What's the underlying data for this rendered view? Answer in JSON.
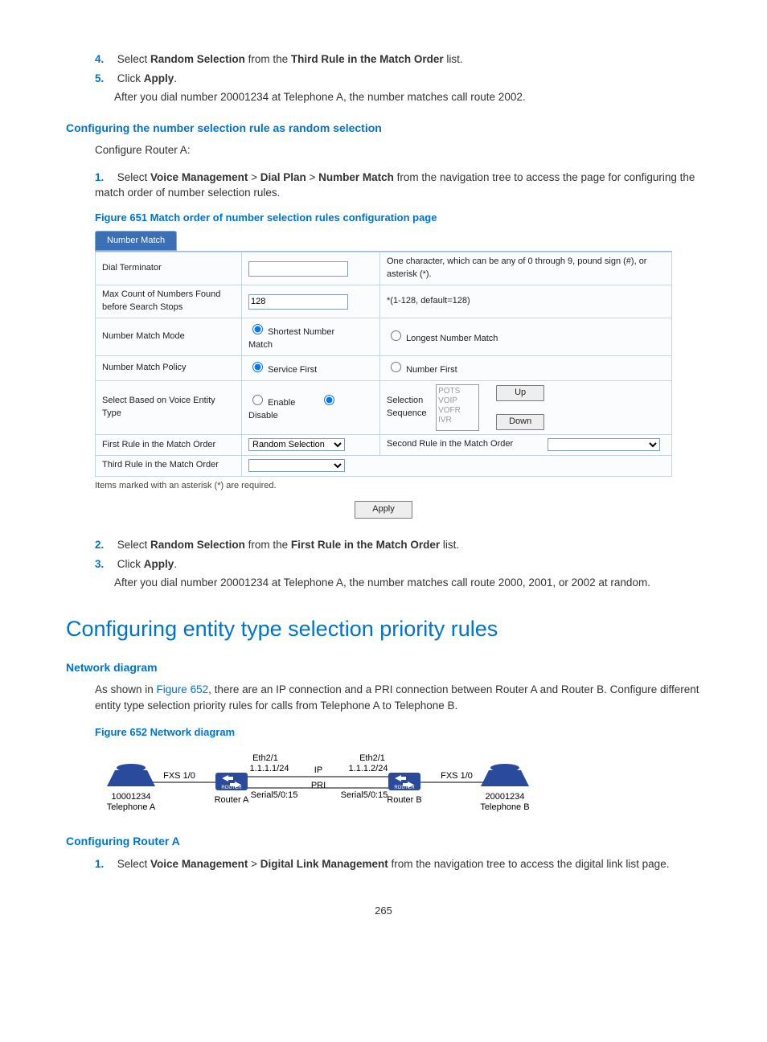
{
  "intro_steps": [
    {
      "num": "4.",
      "prefix": "Select ",
      "bold1": "Random Selection",
      "mid": " from the ",
      "bold2": "Third Rule in the Match Order",
      "suffix": " list."
    },
    {
      "num": "5.",
      "prefix": "Click ",
      "bold1": "Apply",
      "mid": "",
      "bold2": "",
      "suffix": "."
    }
  ],
  "intro_after": "After you dial number 20001234 at Telephone A, the number matches call route 2002.",
  "h3_random": "Configuring the number selection rule as random selection",
  "cfg_router_a": "Configure Router A:",
  "step1": {
    "num": "1.",
    "p1": "Select ",
    "b1": "Voice Management",
    "sep1": " > ",
    "b2": "Dial Plan",
    "sep2": " > ",
    "b3": "Number Match",
    "p2": " from the navigation tree to access the page for configuring the match order of number selection rules."
  },
  "fig651_caption": "Figure 651 Match order of number selection rules configuration page",
  "ui": {
    "tab": "Number Match",
    "rows": {
      "dial_term": {
        "label": "Dial Terminator",
        "value": "",
        "hint": "One character, which can be any of 0 through 9, pound sign (#), or asterisk (*)."
      },
      "max_count": {
        "label": "Max Count of Numbers Found before Search Stops",
        "value": "128",
        "hint": "*(1-128, default=128)"
      },
      "match_mode": {
        "label": "Number Match Mode",
        "o1": "Shortest Number Match",
        "o2": "Longest Number Match"
      },
      "match_policy": {
        "label": "Number Match Policy",
        "o1": "Service First",
        "o2": "Number First"
      },
      "voice_type": {
        "label": "Select Based on Voice Entity Type",
        "o1": "Enable",
        "o2": "Disable",
        "seq_label": "Selection Sequence",
        "seq_items": [
          "POTS",
          "VOIP",
          "VOFR",
          "IVR"
        ],
        "btn_up": "Up",
        "btn_down": "Down"
      },
      "first_rule": {
        "label": "First Rule in the Match Order",
        "value": "Random Selection",
        "label2": "Second Rule in the Match Order",
        "value2": ""
      },
      "third_rule": {
        "label": "Third Rule in the Match Order",
        "value": ""
      }
    },
    "footnote": "Items marked with an asterisk (*) are required.",
    "apply": "Apply"
  },
  "post_steps": {
    "s2": {
      "num": "2.",
      "p1": "Select ",
      "b1": "Random Selection",
      "p2": " from the ",
      "b2": "First Rule in the Match Order",
      "p3": " list."
    },
    "s3": {
      "num": "3.",
      "p1": "Click ",
      "b1": "Apply",
      "p2": "."
    }
  },
  "post_after": "After you dial number 20001234 at Telephone A, the number matches call route 2000, 2001, or 2002 at random.",
  "h2_entity": "Configuring entity type selection priority rules",
  "h3_netdiag": "Network diagram",
  "netdiag_para_a": "As shown in ",
  "netdiag_xref": "Figure 652",
  "netdiag_para_b": ", there are an IP connection and a PRI connection between Router A and Router B. Configure different entity type selection priority rules for calls from Telephone A to Telephone B.",
  "fig652_caption": "Figure 652 Network diagram",
  "net": {
    "fxs_l": "FXS 1/0",
    "fxs_r": "FXS 1/0",
    "eth_l": "Eth2/1",
    "eth_r": "Eth2/1",
    "ip_l": "1.1.1.1/24",
    "ip_r": "1.1.1.2/24",
    "ip_lbl": "IP",
    "pri_lbl": "PRI",
    "ser_l": "Serial5/0:15",
    "ser_r": "Serial5/0:15",
    "ra": "Router A",
    "rb": "Router B",
    "tel_a_num": "10001234",
    "tel_a": "Telephone A",
    "tel_b_num": "20001234",
    "tel_b": "Telephone B"
  },
  "h3_cfg_ra": "Configuring Router A",
  "cfg_ra_step1": {
    "num": "1.",
    "p1": "Select ",
    "b1": "Voice Management",
    "sep": " > ",
    "b2": "Digital Link Management",
    "p2": " from the navigation tree to access the digital link list page."
  },
  "page_num": "265"
}
